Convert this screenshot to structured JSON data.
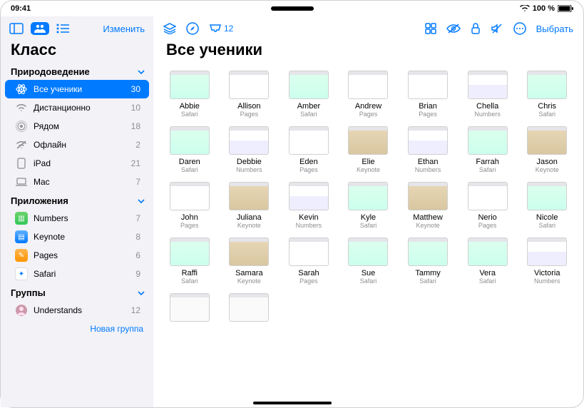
{
  "status": {
    "time": "09:41",
    "battery": "100 %"
  },
  "sidebar": {
    "edit": "Изменить",
    "title": "Класс",
    "sections": [
      {
        "label": "Природоведение",
        "items": [
          {
            "icon": "atom",
            "label": "Все ученики",
            "count": 30,
            "selected": true
          },
          {
            "icon": "wifi",
            "label": "Дистанционно",
            "count": 10
          },
          {
            "icon": "near",
            "label": "Рядом",
            "count": 18
          },
          {
            "icon": "offline",
            "label": "Офлайн",
            "count": 2
          },
          {
            "icon": "ipad",
            "label": "iPad",
            "count": 21
          },
          {
            "icon": "mac",
            "label": "Mac",
            "count": 7
          }
        ]
      },
      {
        "label": "Приложения",
        "items": [
          {
            "icon": "app-numbers",
            "label": "Numbers",
            "count": 7
          },
          {
            "icon": "app-keynote",
            "label": "Keynote",
            "count": 8
          },
          {
            "icon": "app-pages",
            "label": "Pages",
            "count": 6
          },
          {
            "icon": "app-safari",
            "label": "Safari",
            "count": 9
          }
        ]
      },
      {
        "label": "Группы",
        "items": [
          {
            "icon": "avatar",
            "label": "Understands",
            "count": 12
          }
        ]
      }
    ],
    "new_group": "Новая группа"
  },
  "main": {
    "inbox_count": "12",
    "select": "Выбрать",
    "title": "Все ученики",
    "students": [
      {
        "name": "Abbie",
        "app": "Safari"
      },
      {
        "name": "Allison",
        "app": "Pages"
      },
      {
        "name": "Amber",
        "app": "Safari"
      },
      {
        "name": "Andrew",
        "app": "Pages"
      },
      {
        "name": "Brian",
        "app": "Pages"
      },
      {
        "name": "Chella",
        "app": "Numbers"
      },
      {
        "name": "Chris",
        "app": "Safari"
      },
      {
        "name": "Daren",
        "app": "Safari"
      },
      {
        "name": "Debbie",
        "app": "Numbers"
      },
      {
        "name": "Eden",
        "app": "Pages"
      },
      {
        "name": "Elie",
        "app": "Keynote"
      },
      {
        "name": "Ethan",
        "app": "Numbers"
      },
      {
        "name": "Farrah",
        "app": "Safari"
      },
      {
        "name": "Jason",
        "app": "Keynote"
      },
      {
        "name": "John",
        "app": "Pages"
      },
      {
        "name": "Juliana",
        "app": "Keynote"
      },
      {
        "name": "Kevin",
        "app": "Numbers"
      },
      {
        "name": "Kyle",
        "app": "Safari"
      },
      {
        "name": "Matthew",
        "app": "Keynote"
      },
      {
        "name": "Nerio",
        "app": "Pages"
      },
      {
        "name": "Nicole",
        "app": "Safari"
      },
      {
        "name": "Raffi",
        "app": "Safari"
      },
      {
        "name": "Samara",
        "app": "Keynote"
      },
      {
        "name": "Sarah",
        "app": "Pages"
      },
      {
        "name": "Sue",
        "app": "Safari"
      },
      {
        "name": "Tammy",
        "app": "Safari"
      },
      {
        "name": "Vera",
        "app": "Safari"
      },
      {
        "name": "Victoria",
        "app": "Numbers"
      },
      {
        "name": "",
        "app": ""
      },
      {
        "name": "",
        "app": ""
      }
    ]
  }
}
